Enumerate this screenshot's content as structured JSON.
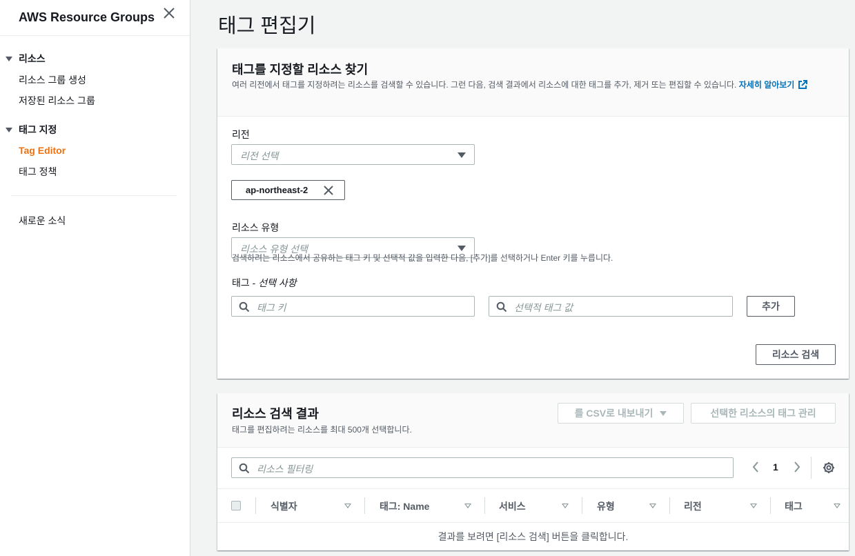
{
  "sidebar": {
    "title": "AWS Resource Groups",
    "sections": [
      {
        "label": "리소스",
        "items": [
          "리소스 그룹 생성",
          "저장된 리소스 그룹"
        ]
      },
      {
        "label": "태그 지정",
        "items": [
          "Tag Editor",
          "태그 정책"
        ]
      }
    ],
    "footer_link": "새로운 소식"
  },
  "page": {
    "title": "태그 편집기"
  },
  "find_panel": {
    "title": "태그를 지정할 리소스 찾기",
    "description": "여러 리전에서 태그를 지정하려는 리소스를 검색할 수 있습니다. 그런 다음, 검색 결과에서 리소스에 대한 태그를 추가, 제거 또는 편집할 수 있습니다.",
    "learn_more": "자세히 알아보기",
    "region_label": "리전",
    "region_placeholder": "리전 선택",
    "selected_region": "ap-northeast-2",
    "resource_type_label": "리소스 유형",
    "resource_type_placeholder": "리소스 유형 선택",
    "tags_label": "태그 - ",
    "tags_label_optional": "선택 사항",
    "tag_key_placeholder": "태그 키",
    "tag_value_placeholder": "선택적 태그 값",
    "add_button": "추가",
    "hint": "검색하려는 리소스에서 공유하는 태그 키 및 선택적 값을 입력한 다음, [추가]를 선택하거나 Enter 키를 누릅니다.",
    "search_button": "리소스 검색"
  },
  "results_panel": {
    "title": "리소스 검색 결과",
    "description": "태그를 편집하려는 리소스를 최대 500개 선택합니다.",
    "export_button": "를 CSV로 내보내기",
    "manage_button": "선택한 리소스의 태그 관리",
    "filter_placeholder": "리소스 필터링",
    "page_number": "1",
    "columns": [
      "식별자",
      "태그: Name",
      "서비스",
      "유형",
      "리전",
      "태그"
    ],
    "empty_message": "결과를 보려면 [리소스 검색] 버튼을 클릭합니다."
  },
  "colors": {
    "accent_orange": "#ec7211",
    "link_blue": "#0073bb",
    "background": "#f2f3f3"
  }
}
